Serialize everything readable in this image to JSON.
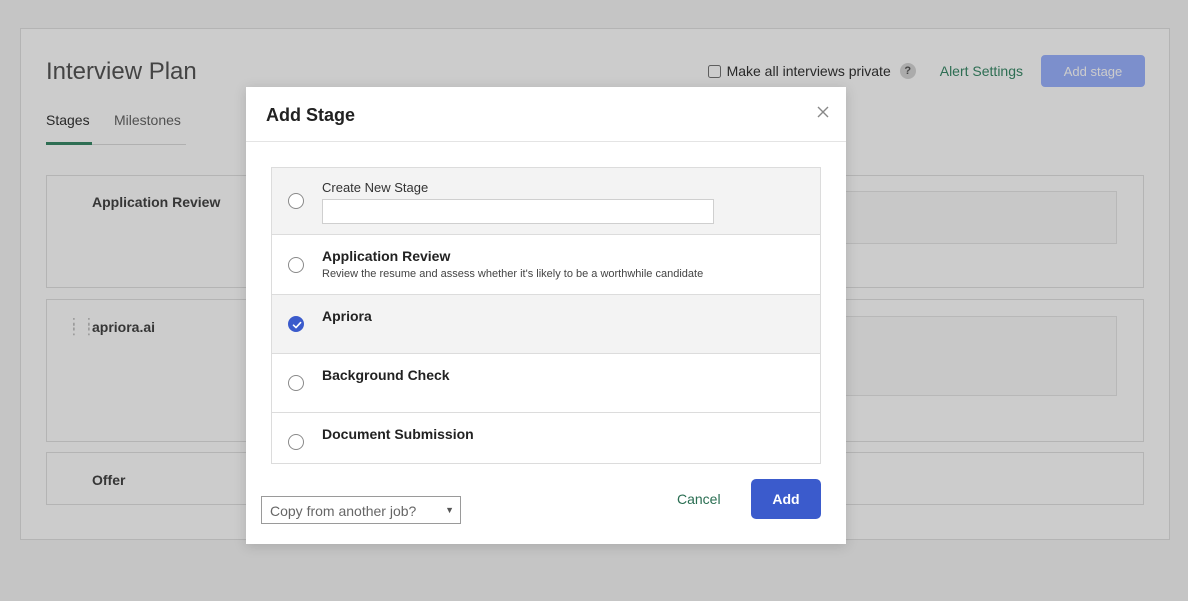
{
  "page": {
    "title": "Interview Plan",
    "private_checkbox_label": "Make all interviews private",
    "help_icon": "?",
    "alert_settings": "Alert Settings",
    "add_stage_button": "Add stage",
    "tabs": [
      {
        "label": "Stages",
        "active": true
      },
      {
        "label": "Milestones",
        "active": false
      }
    ],
    "stages": [
      {
        "name": "Application Review"
      },
      {
        "name": "apriora.ai"
      },
      {
        "name": "Offer"
      }
    ]
  },
  "modal": {
    "title": "Add Stage",
    "close_icon": "close-icon",
    "options": [
      {
        "label": "Create New Stage",
        "input_value": "",
        "selected": false
      },
      {
        "label": "Application Review",
        "description": "Review the resume and assess whether it's likely to be a worthwhile candidate",
        "selected": false
      },
      {
        "label": "Apriora",
        "selected": true
      },
      {
        "label": "Background Check",
        "selected": false
      },
      {
        "label": "Document Submission",
        "selected": false
      }
    ],
    "copy_select": {
      "value": "Copy from another job?"
    },
    "cancel_label": "Cancel",
    "add_label": "Add"
  },
  "colors": {
    "primary_blue": "#3b5bcc",
    "green_link": "#3a8a68",
    "disabled_blue": "#9cb3ff"
  }
}
